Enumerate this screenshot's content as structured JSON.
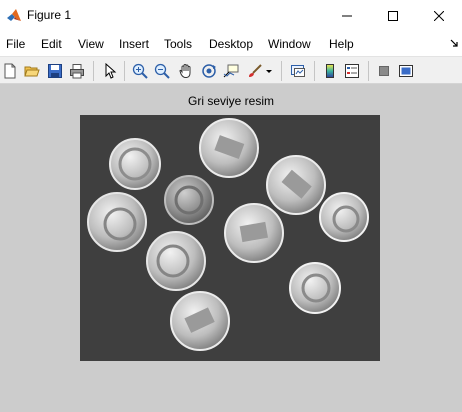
{
  "window": {
    "title": "Figure 1",
    "app_icon": "matlab-logo-icon",
    "controls": [
      "minimize-icon",
      "maximize-icon",
      "close-icon"
    ]
  },
  "menu": {
    "items": [
      "File",
      "Edit",
      "View",
      "Insert",
      "Tools",
      "Desktop",
      "Window",
      "Help"
    ]
  },
  "toolbar": {
    "buttons": [
      "new-figure-icon",
      "open-file-icon",
      "save-icon",
      "print-icon",
      "edit-plot-icon",
      "zoom-in-icon",
      "zoom-out-icon",
      "pan-icon",
      "rotate-3d-icon",
      "data-cursor-icon",
      "brush-icon",
      "link-plot-icon",
      "colorbar-icon",
      "legend-icon",
      "hide-plot-tools-icon",
      "show-plot-tools-icon"
    ]
  },
  "figure": {
    "axes_title": "Gri seviye resim",
    "image_description_icon": "grayscale-coins-image",
    "background_color": "#cccccc"
  }
}
